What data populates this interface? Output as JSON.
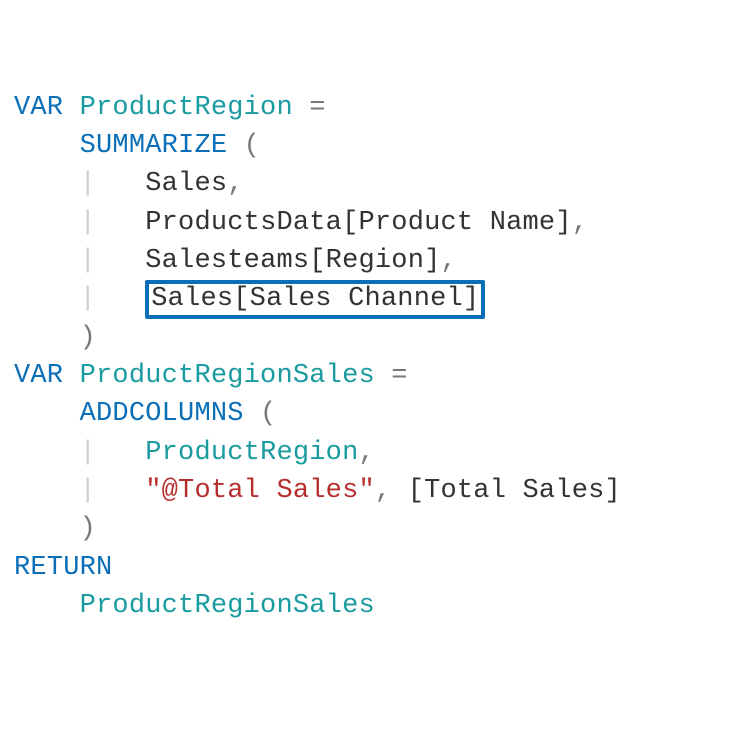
{
  "code": {
    "kw_var1": "VAR",
    "var1_name": "ProductRegion",
    "eq1": " =",
    "func_summarize": "SUMMARIZE",
    "paren_open1": " (",
    "arg_sales": "Sales",
    "comma1": ",",
    "arg_products": "ProductsData[Product Name]",
    "comma2": ",",
    "arg_salesteams": "Salesteams[Region]",
    "comma3": ",",
    "arg_saleschannel": "Sales[Sales Channel]",
    "paren_close1": ")",
    "kw_var2": "VAR",
    "var2_name": "ProductRegionSales",
    "eq2": " =",
    "func_addcolumns": "ADDCOLUMNS",
    "paren_open2": " (",
    "arg_productregion": "ProductRegion",
    "comma4": ",",
    "str_total": "\"@Total Sales\"",
    "comma5": ",",
    "bracket_total": " [Total Sales]",
    "paren_close2": ")",
    "kw_return": "RETURN",
    "return_expr": "ProductRegionSales"
  },
  "highlight": {
    "target": "Sales[Sales Channel]"
  },
  "indent": {
    "i1": "    ",
    "i2": "        "
  }
}
